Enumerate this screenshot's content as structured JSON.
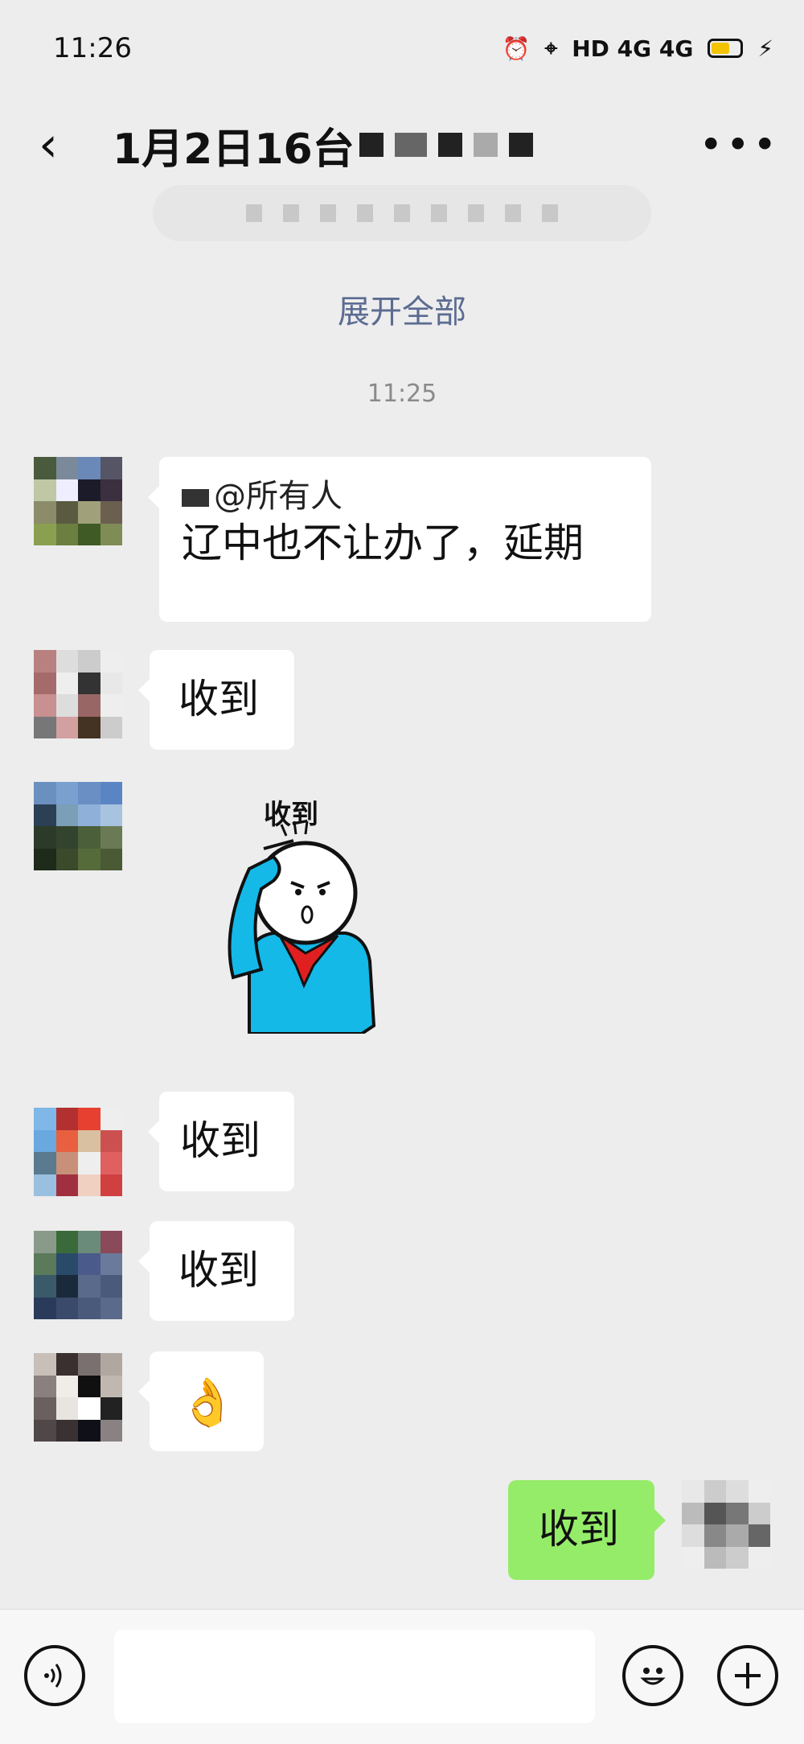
{
  "status_bar": {
    "time": "11:26",
    "network": "HD 4G 4G"
  },
  "header": {
    "title": "1月2日16台"
  },
  "notice": {
    "expand_label": "展开全部"
  },
  "timestamp": "11:25",
  "messages": [
    {
      "mention": "@所有人",
      "text": "辽中也不让办了，延期"
    },
    {
      "text": "收到"
    },
    {
      "sticker_caption": "收到"
    },
    {
      "text": "收到"
    },
    {
      "text": "收到"
    },
    {
      "emoji": "👌"
    },
    {
      "text": "收到",
      "self": true
    }
  ],
  "colors": {
    "background": "#ededed",
    "self_bubble": "#95ec69",
    "link": "#5b6b92"
  },
  "icons": {
    "back": "chevron-left-icon",
    "more": "more-dots-icon",
    "voice": "voice-icon",
    "emoji": "smile-icon",
    "plus": "plus-icon"
  }
}
